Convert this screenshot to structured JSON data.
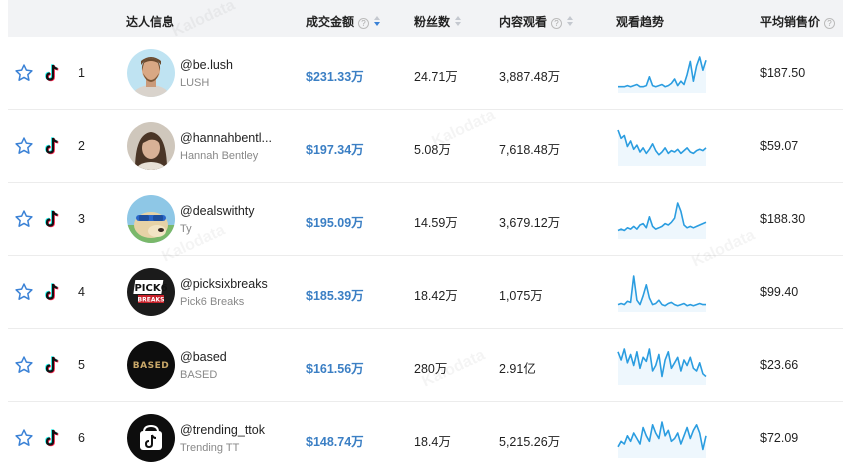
{
  "columns": {
    "creator_info": "达人信息",
    "gmv": "成交金额",
    "followers": "粉丝数",
    "content_views": "内容观看",
    "view_trend": "观看趋势",
    "avg_price": "平均销售价",
    "help_glyph": "?"
  },
  "rows": [
    {
      "rank": "1",
      "handle": "@be.lush",
      "nickname": "LUSH⁡",
      "gmv": "$231.33万",
      "followers": "24.71万",
      "views": "3,887.48万",
      "avg_price": "$187.50",
      "trend": [
        3,
        3,
        3,
        4,
        3,
        4,
        5,
        3,
        3,
        4,
        12,
        4,
        3,
        4,
        5,
        3,
        4,
        6,
        10,
        4,
        8,
        5,
        14,
        26,
        8,
        22,
        30,
        18,
        27
      ]
    },
    {
      "rank": "2",
      "handle": "@hannahbentl...",
      "nickname": "Hannah Bentley",
      "gmv": "$197.34万",
      "followers": "5.08万",
      "views": "7,618.48万",
      "avg_price": "$59.07",
      "trend": [
        24,
        18,
        20,
        12,
        16,
        10,
        13,
        8,
        11,
        7,
        10,
        14,
        9,
        6,
        8,
        11,
        7,
        9,
        8,
        10,
        7,
        9,
        11,
        8,
        7,
        9,
        10,
        9,
        11
      ]
    },
    {
      "rank": "3",
      "handle": "@dealswithty",
      "nickname": "Ty",
      "gmv": "$195.09万",
      "followers": "14.59万",
      "views": "3,679.12万",
      "avg_price": "$188.30",
      "trend": [
        4,
        5,
        4,
        6,
        5,
        7,
        5,
        8,
        9,
        6,
        14,
        7,
        5,
        6,
        7,
        9,
        8,
        10,
        13,
        24,
        18,
        8,
        6,
        7,
        6,
        7,
        8,
        9,
        10
      ]
    },
    {
      "rank": "4",
      "handle": "@picksixbreaks",
      "nickname": "Pick6 Breaks",
      "gmv": "$185.39万",
      "followers": "18.42万",
      "views": "1,075万",
      "avg_price": "$99.40",
      "trend": [
        4,
        5,
        4,
        7,
        6,
        30,
        8,
        4,
        12,
        22,
        10,
        4,
        5,
        8,
        4,
        3,
        5,
        6,
        4,
        3,
        4,
        5,
        3,
        4,
        3,
        4,
        5,
        4,
        4
      ]
    },
    {
      "rank": "5",
      "handle": "@based",
      "nickname": "BASED",
      "gmv": "$161.56万",
      "followers": "280万",
      "views": "2.91亿",
      "avg_price": "$23.66",
      "trend": [
        22,
        16,
        24,
        14,
        20,
        12,
        22,
        10,
        18,
        15,
        24,
        8,
        12,
        20,
        4,
        16,
        22,
        10,
        14,
        18,
        8,
        16,
        12,
        18,
        10,
        8,
        14,
        6,
        4
      ]
    },
    {
      "rank": "6",
      "handle": "@trending_ttok",
      "nickname": "Trending TT",
      "gmv": "$148.74万",
      "followers": "18.4万",
      "views": "5,215.26万",
      "avg_price": "$72.09",
      "trend": [
        6,
        10,
        8,
        14,
        10,
        16,
        12,
        8,
        20,
        14,
        10,
        22,
        16,
        12,
        24,
        14,
        18,
        10,
        12,
        16,
        8,
        14,
        20,
        12,
        18,
        22,
        16,
        4,
        14
      ]
    }
  ],
  "colors": {
    "accent": "#3b82d6",
    "spark": "#2b9de0",
    "gmv": "#3b7fc4"
  },
  "icons": {
    "favorite": "star-outline-icon",
    "platform": "tiktok-icon"
  }
}
